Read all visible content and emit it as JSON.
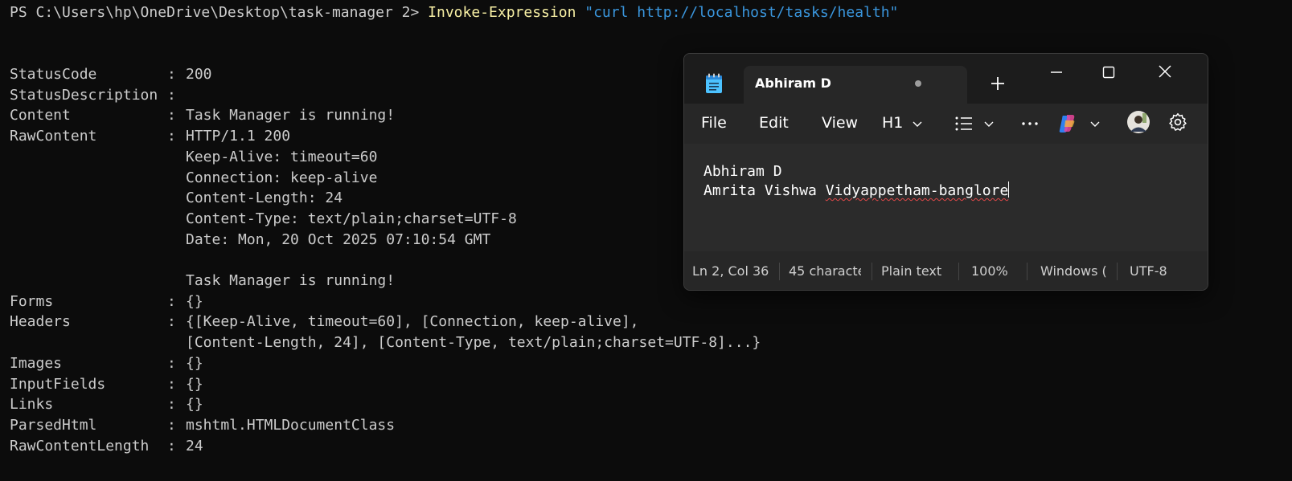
{
  "terminal": {
    "prompt": "PS C:\\Users\\hp\\OneDrive\\Desktop\\task-manager 2> ",
    "command": "Invoke-Expression",
    "argument": "\"curl http://localhost/tasks/health\"",
    "output": [
      {
        "key": "StatusCode",
        "value": "200"
      },
      {
        "key": "StatusDescription",
        "value": ""
      },
      {
        "key": "Content",
        "value": "Task Manager is running!"
      },
      {
        "key": "RawContent",
        "value": "HTTP/1.1 200"
      },
      {
        "key": "",
        "value": "Keep-Alive: timeout=60"
      },
      {
        "key": "",
        "value": "Connection: keep-alive"
      },
      {
        "key": "",
        "value": "Content-Length: 24"
      },
      {
        "key": "",
        "value": "Content-Type: text/plain;charset=UTF-8"
      },
      {
        "key": "",
        "value": "Date: Mon, 20 Oct 2025 07:10:54 GMT"
      },
      {
        "key": "",
        "value": ""
      },
      {
        "key": "",
        "value": "Task Manager is running!"
      },
      {
        "key": "Forms",
        "value": "{}"
      },
      {
        "key": "Headers",
        "value": "{[Keep-Alive, timeout=60], [Connection, keep-alive],"
      },
      {
        "key": "",
        "value": "[Content-Length, 24], [Content-Type, text/plain;charset=UTF-8]...}"
      },
      {
        "key": "Images",
        "value": "{}"
      },
      {
        "key": "InputFields",
        "value": "{}"
      },
      {
        "key": "Links",
        "value": "{}"
      },
      {
        "key": "ParsedHtml",
        "value": "mshtml.HTMLDocumentClass"
      },
      {
        "key": "RawContentLength",
        "value": "24"
      }
    ]
  },
  "notepad": {
    "tab_title": "Abhiram D",
    "menu": {
      "file": "File",
      "edit": "Edit",
      "view": "View",
      "heading": "H1"
    },
    "content": {
      "line1": "Abhiram D",
      "line2_prefix": "Amrita Vishwa ",
      "line2_misspelled": "Vidyappetham-banglore"
    },
    "status": {
      "position": "Ln 2, Col 36",
      "characters": "45 characte",
      "format": "Plain text",
      "zoom": "100%",
      "line_ending": "Windows (",
      "encoding": "UTF-8"
    },
    "icons": {
      "app": "notepad-icon",
      "new_tab": "plus-icon",
      "minimize": "minimize-icon",
      "maximize": "maximize-icon",
      "close": "close-icon",
      "list": "bulleted-list-icon",
      "more": "more-icon",
      "copilot": "copilot-icon",
      "avatar": "avatar",
      "settings": "gear-icon"
    },
    "colors": {
      "terminal_bg": "#0c0c0c",
      "command": "#f9f1a5",
      "string": "#3a96dd",
      "window_bg": "#272727",
      "titlebar_bg": "#1c1c1c"
    }
  }
}
